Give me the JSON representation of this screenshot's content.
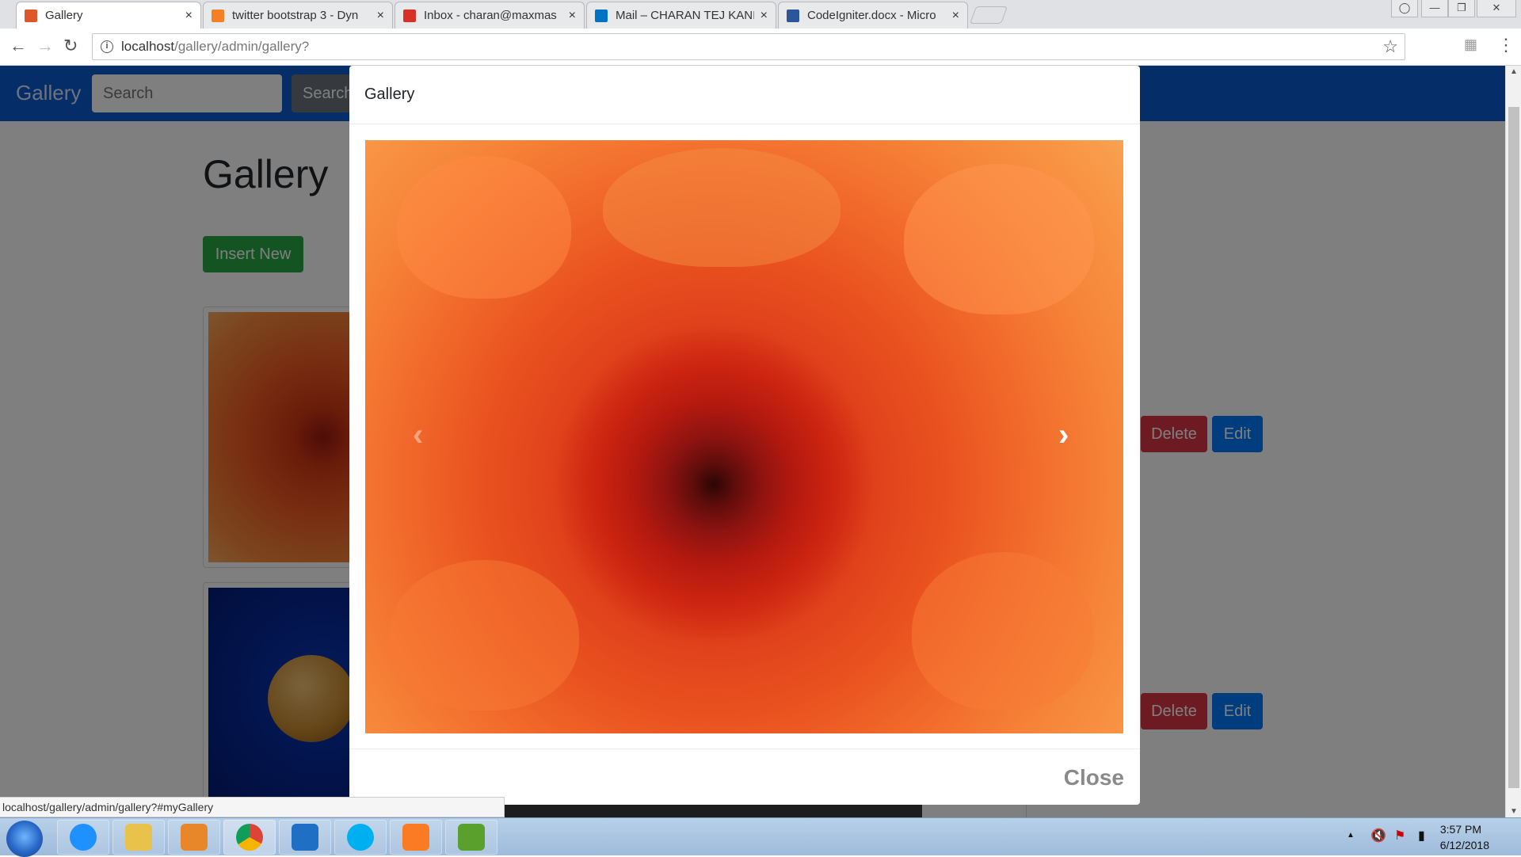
{
  "browser": {
    "tabs": [
      {
        "title": "Gallery",
        "favicon_color": "#e0562b"
      },
      {
        "title": "twitter bootstrap 3 - Dyn",
        "favicon_color": "#f48024"
      },
      {
        "title": "Inbox - charan@maxmas",
        "favicon_color": "#d93025"
      },
      {
        "title": "Mail – CHARAN TEJ KANI",
        "favicon_color": "#0072c6"
      },
      {
        "title": "CodeIgniter.docx - Micro",
        "favicon_color": "#2b579a"
      }
    ],
    "tab_close_glyph": "×",
    "url_host": "localhost",
    "url_path": "/gallery/admin/gallery?",
    "status_url": "localhost/gallery/admin/gallery?#myGallery"
  },
  "app": {
    "brand": "Gallery",
    "search_placeholder": "Search",
    "search_button": "Search",
    "page_title": "Gallery",
    "insert_button": "Insert New",
    "items": [
      {
        "delete_label": "Delete",
        "edit_label": "Edit"
      },
      {
        "delete_label": "Delete",
        "edit_label": "Edit"
      }
    ]
  },
  "modal": {
    "title": "Gallery",
    "close_label": "Close",
    "prev_glyph": "‹",
    "next_glyph": "›"
  },
  "taskbar": {
    "apps": [
      "internet-explorer-icon",
      "file-explorer-icon",
      "media-player-icon",
      "chrome-icon",
      "vscode-icon",
      "skype-icon",
      "xampp-icon",
      "notepad-icon"
    ],
    "app_colors": [
      "#1e90ff",
      "#e8c24a",
      "#e8872a",
      "#db4437",
      "#1f6fc5",
      "#00aff0",
      "#fb7a24",
      "#5aa02c"
    ],
    "time": "3:57 PM",
    "date": "6/12/2018"
  },
  "colors": {
    "navbar": "#0a5bd1",
    "delete": "#dc3545",
    "edit": "#007bff",
    "insert": "#28a745"
  }
}
